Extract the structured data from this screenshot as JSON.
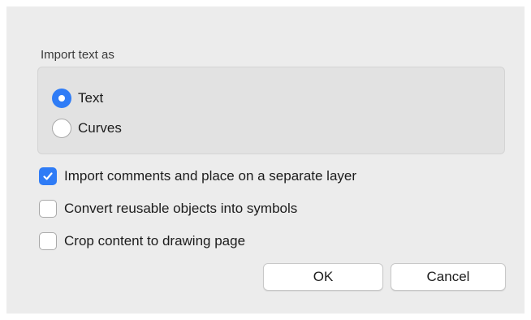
{
  "import_text": {
    "group_label": "Import text as",
    "options": [
      {
        "label": "Text",
        "selected": true
      },
      {
        "label": "Curves",
        "selected": false
      }
    ]
  },
  "checkboxes": [
    {
      "label": "Import comments and place on a separate layer",
      "checked": true
    },
    {
      "label": "Convert reusable objects into symbols",
      "checked": false
    },
    {
      "label": "Crop content to drawing page",
      "checked": false
    }
  ],
  "buttons": {
    "ok_label": "OK",
    "cancel_label": "Cancel"
  },
  "colors": {
    "accent": "#2f7cf6",
    "dialog_bg": "#ececec",
    "group_bg": "#e2e2e2"
  }
}
